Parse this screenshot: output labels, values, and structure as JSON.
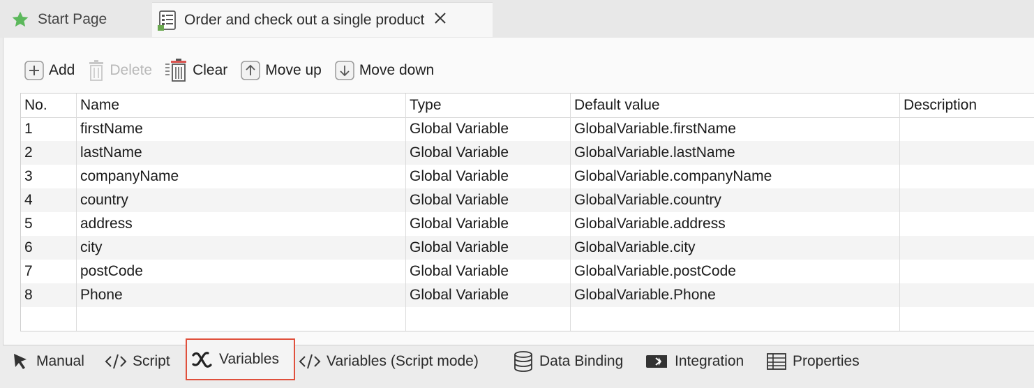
{
  "tabs": [
    {
      "label": "Start Page",
      "icon": "star-icon"
    },
    {
      "label": "Order and check out a single product",
      "icon": "test-case-icon"
    }
  ],
  "toolbar": {
    "add": "Add",
    "delete": "Delete",
    "clear": "Clear",
    "move_up": "Move up",
    "move_down": "Move down"
  },
  "table": {
    "columns": [
      "No.",
      "Name",
      "Type",
      "Default value",
      "Description"
    ],
    "rows": [
      [
        "1",
        "firstName",
        "Global Variable",
        "GlobalVariable.firstName",
        ""
      ],
      [
        "2",
        "lastName",
        "Global Variable",
        "GlobalVariable.lastName",
        ""
      ],
      [
        "3",
        "companyName",
        "Global Variable",
        "GlobalVariable.companyName",
        ""
      ],
      [
        "4",
        "country",
        "Global Variable",
        "GlobalVariable.country",
        ""
      ],
      [
        "5",
        "address",
        "Global Variable",
        "GlobalVariable.address",
        ""
      ],
      [
        "6",
        "city",
        "Global Variable",
        "GlobalVariable.city",
        ""
      ],
      [
        "7",
        "postCode",
        "Global Variable",
        "GlobalVariable.postCode",
        ""
      ],
      [
        "8",
        "Phone",
        "Global Variable",
        "GlobalVariable.Phone",
        ""
      ]
    ]
  },
  "bottom_tabs": [
    {
      "label": "Manual",
      "icon": "cursor-arrow-icon"
    },
    {
      "label": "Script",
      "icon": "code-icon"
    },
    {
      "label": "Variables",
      "icon": "variable-x-icon"
    },
    {
      "label": "Variables (Script mode)",
      "icon": "code-icon"
    },
    {
      "label": "Data Binding",
      "icon": "database-icon"
    },
    {
      "label": "Integration",
      "icon": "integration-icon"
    },
    {
      "label": "Properties",
      "icon": "table-grid-icon"
    }
  ],
  "colors": {
    "accent": "#e0503c",
    "star": "#5cb85c"
  }
}
